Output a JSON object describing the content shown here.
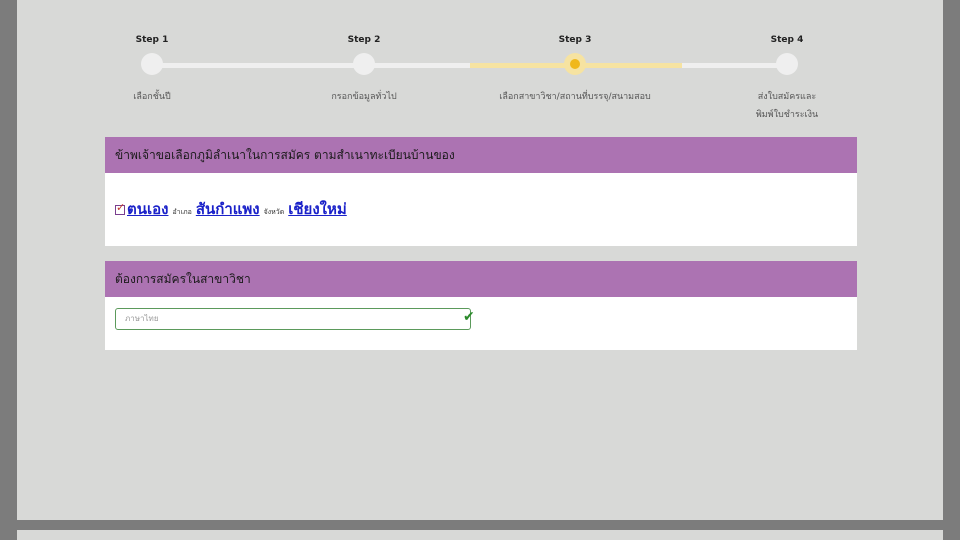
{
  "stepper": {
    "steps": [
      {
        "title": "Step 1",
        "label": "เลือกชั้นปี",
        "state": "done"
      },
      {
        "title": "Step 2",
        "label": "กรอกข้อมูลทั่วไป",
        "state": "done"
      },
      {
        "title": "Step 3",
        "label": "เลือกสาขาวิชา/สถานที่บรรจุ/สนามสอบ",
        "state": "active"
      },
      {
        "title": "Step 4",
        "label": "ส่งใบสมัครและ\nพิมพ์ใบชำระเงิน",
        "state": "pending"
      }
    ],
    "colors": {
      "track": "#efefef",
      "active_track": "#f6e3a1",
      "active_dot": "#f0b81c"
    }
  },
  "domicile_panel": {
    "header": "ข้าพเจ้าขอเลือกภูมิลำเนาในการสมัคร ตามสำเนาทะเบียนบ้านของ",
    "owner_link": "ตนเอง",
    "district_prefix": "อำเภอ",
    "district_link": "สันกำแพง",
    "province_prefix": "จังหวัด",
    "province_link": "เชียงใหม่",
    "checked": true
  },
  "major_panel": {
    "header": "ต้องการสมัครในสาขาวิชา",
    "select_value": "ภาษาไทย",
    "valid_icon": "check-icon"
  },
  "theme": {
    "panel_header_bg": "#ac73b2",
    "link_color": "#1a21c9",
    "page_bg": "#d8d9d7",
    "outer_bg": "#7c7c7c",
    "valid_color": "#2a8a2a"
  }
}
